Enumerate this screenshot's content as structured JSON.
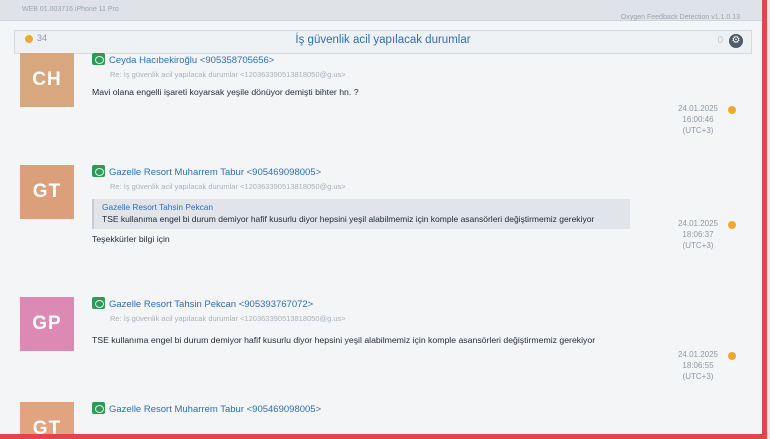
{
  "topbar": {
    "left_text": "WEB 01.003716 iPhone 11 Pro",
    "right_text": "Oxygen Feedback Detection v1.1.0.13"
  },
  "header": {
    "count": "34",
    "title": "İş güvenlik acil yapılacak durumlar",
    "zero": "0"
  },
  "messages": [
    {
      "initials": "CH",
      "avatar_color": "#d9a77d",
      "sender": "Ceyda Hacıbekiroğlu <905358705656>",
      "subject": "Re: İş güvenlik acil yapılacak durumlar <120363390513818050@g.us>",
      "body": "Mavi olana engelli işareti koyarsak yeşile dönüyor demişti bihter hn. ?",
      "time": [
        "24.01.2025",
        "16:00:46",
        "(UTC+3)"
      ]
    },
    {
      "initials": "GT",
      "avatar_color": "#dba07a",
      "sender": "Gazelle Resort  Muharrem Tabur <905469098005>",
      "subject": "Re: İş güvenlik acil yapılacak durumlar <120363390513818050@g.us>",
      "quote_author": "Gazelle Resort Tahsin Pekcan",
      "quote_text": "TSE kullanıma engel bi durum demiyor hafif kusurlu diyor hepsini  yeşil alabilmemiz için komple asansörleri değiştirmemiz gerekiyor",
      "reply": "Teşekkürler bilgi için",
      "time": [
        "24.01.2025",
        "18:06:37",
        "(UTC+3)"
      ]
    },
    {
      "initials": "GP",
      "avatar_color": "#dc8ab4",
      "sender": "Gazelle Resort  Tahsin Pekcan <905393767072>",
      "subject": "Re: İş güvenlik acil yapılacak durumlar <120363390513818050@g.us>",
      "body": "TSE kullanıma engel bi durum demiyor hafif kusurlu diyor hepsini  yeşil alabilmemiz için komple asansörleri değiştirmemiz gerekiyor",
      "time": [
        "24.01.2025",
        "18:06:55",
        "(UTC+3)"
      ]
    },
    {
      "initials": "GT",
      "avatar_color": "#e1a47f",
      "sender": "Gazelle Resort  Muharrem Tabur <905469098005>"
    }
  ]
}
